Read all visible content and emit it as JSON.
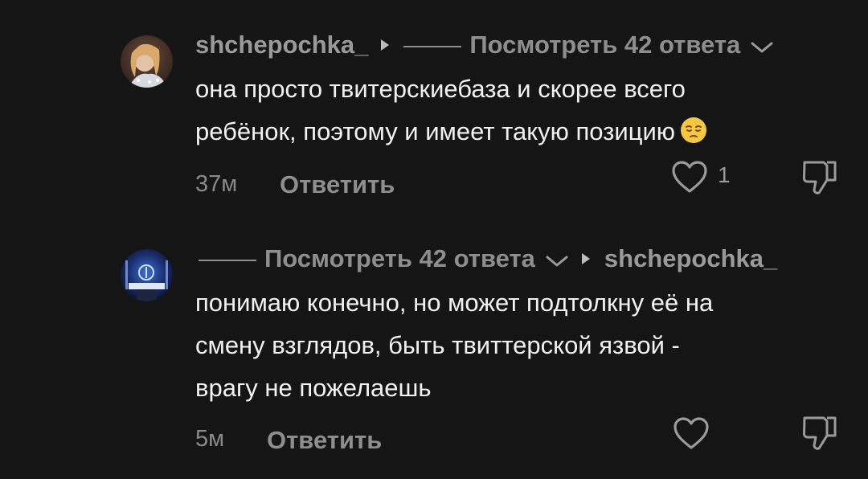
{
  "comments": [
    {
      "username": "shchepochka_",
      "view_replies": "Посмотреть 42 ответа",
      "text_line1": "она просто твитерскиебаза и скорее всего",
      "text_line2": "ребёнок, поэтому и имеет такую позицию",
      "emoji": "pensive-face-icon",
      "time": "37м",
      "reply_label": "Ответить",
      "like_count": "1"
    },
    {
      "view_replies": "Посмотреть 42 ответа",
      "reply_to": "shchepochka_",
      "text_line1": "понимаю конечно, но может подтолкну её на",
      "text_line2": "смену взглядов, быть твиттерской язвой -",
      "text_line3": "врагу не пожелаешь",
      "time": "5м",
      "reply_label": "Ответить"
    }
  ],
  "colors": {
    "background": "#151515",
    "text": "#f2f2f2",
    "muted": "#8e8e8e"
  }
}
